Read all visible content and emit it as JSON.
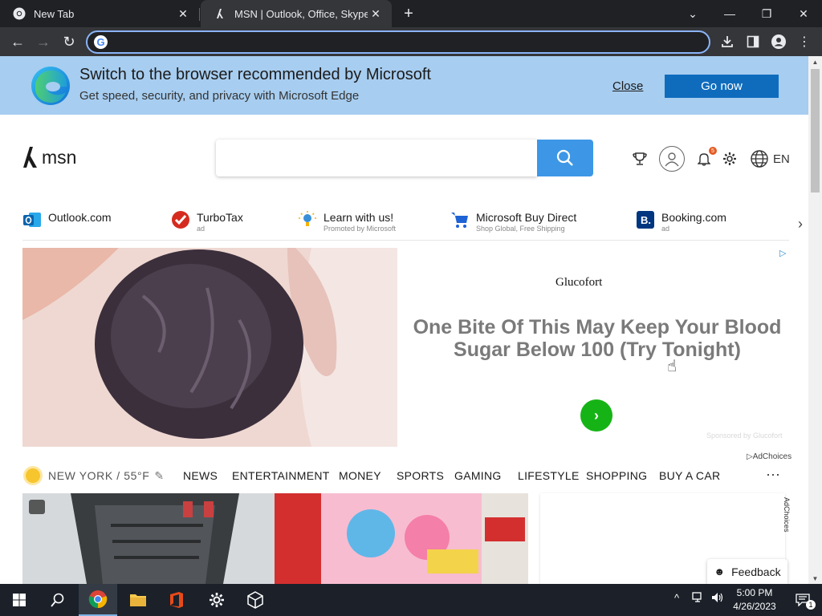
{
  "browser": {
    "tabs": [
      {
        "title": "New Tab",
        "active": false
      },
      {
        "title": "MSN | Outlook, Office, Skype, Bing",
        "active": true
      }
    ],
    "address_value": "",
    "address_placeholder": ""
  },
  "edge_banner": {
    "title": "Switch to the browser recommended by Microsoft",
    "subtitle": "Get speed, security, and privacy with Microsoft Edge",
    "close_label": "Close",
    "go_label": "Go now"
  },
  "header": {
    "logo_text": "msn",
    "search_value": "",
    "notification_count": "5",
    "language": "EN"
  },
  "quick_links": [
    {
      "label": "Outlook.com",
      "sub": ""
    },
    {
      "label": "TurboTax",
      "sub": "ad"
    },
    {
      "label": "Learn with us!",
      "sub": "Promoted by Microsoft"
    },
    {
      "label": "Microsoft Buy Direct",
      "sub": "Shop Global, Free Shipping"
    },
    {
      "label": "Booking.com",
      "sub": "ad"
    }
  ],
  "ad": {
    "brand": "Glucofort",
    "headline": "One Bite Of This May Keep Your Blood Sugar Below 100 (Try Tonight)",
    "sponsored": "Sponsored by Glucofort"
  },
  "nav": {
    "weather": "NEW YORK / 55°F",
    "categories": [
      "NEWS",
      "ENTERTAINMENT",
      "MONEY",
      "SPORTS",
      "GAMING",
      "LIFESTYLE",
      "SHOPPING",
      "BUY A CAR"
    ],
    "adchoices": "AdChoices"
  },
  "side_card": {
    "adchoices": "AdChoices"
  },
  "feedback_label": "Feedback",
  "taskbar": {
    "time": "5:00 PM",
    "date": "4/26/2023",
    "notification_count": "1"
  },
  "colors": {
    "banner_bg": "#a7cdf0",
    "go_button": "#0f6cbd",
    "search_button": "#3d97e6",
    "ad_cta": "#16b316",
    "browser_frame": "#202124",
    "taskbar": "#1b2029"
  }
}
